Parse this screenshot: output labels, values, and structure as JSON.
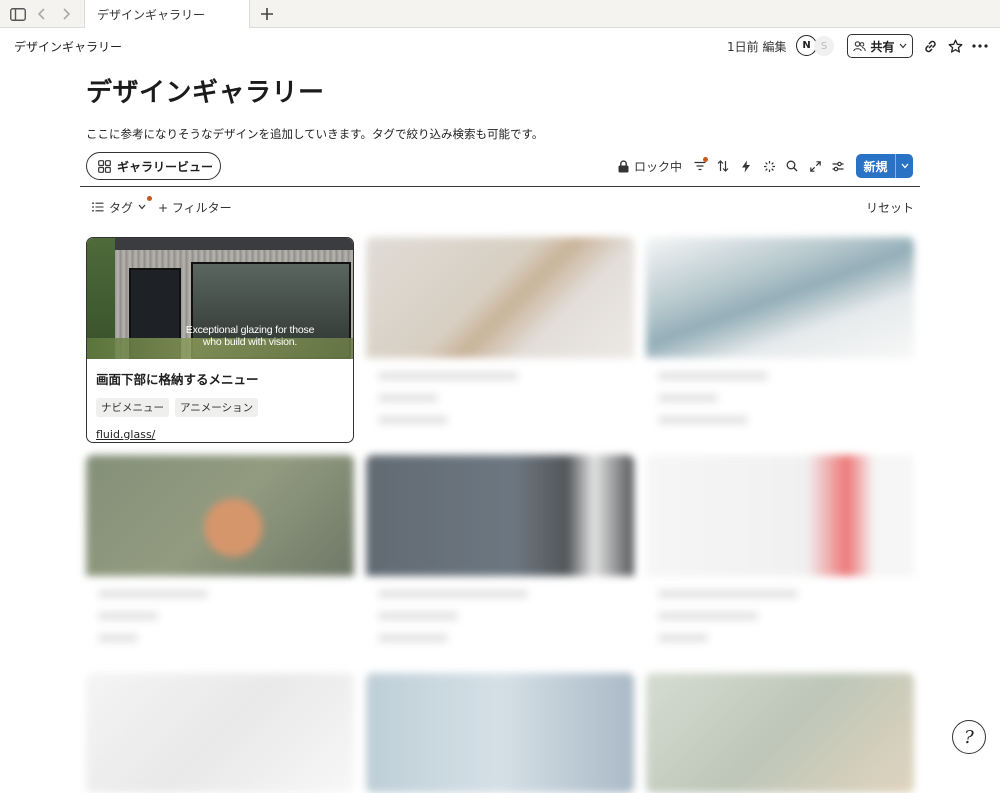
{
  "browser": {
    "tab_title": "デザインギャラリー"
  },
  "topbar": {
    "breadcrumb": "デザインギャラリー",
    "edited": "1日前 編集",
    "avatar_initial": "N",
    "avatar2_initial": "S",
    "share_label": "共有"
  },
  "page": {
    "title": "デザインギャラリー",
    "description": "ここに参考になりそうなデザインを追加していきます。タグで絞り込み検索も可能です。"
  },
  "toolbar": {
    "view_label": "ギャラリービュー",
    "lock_label": "ロック中",
    "new_label": "新規"
  },
  "filters": {
    "tag_label": "タグ",
    "add_filter_label": "+ フィルター",
    "reset_label": "リセット"
  },
  "main_card": {
    "image_caption_line1": "Exceptional glazing for those",
    "image_caption_line2": "who build with vision.",
    "title": "画面下部に格納するメニュー",
    "tags": [
      "ナビメニュー",
      "アニメーション"
    ],
    "url": "fluid.glass/"
  },
  "colors": {
    "accent": "#2a72c5",
    "indicator": "#c8581e"
  }
}
